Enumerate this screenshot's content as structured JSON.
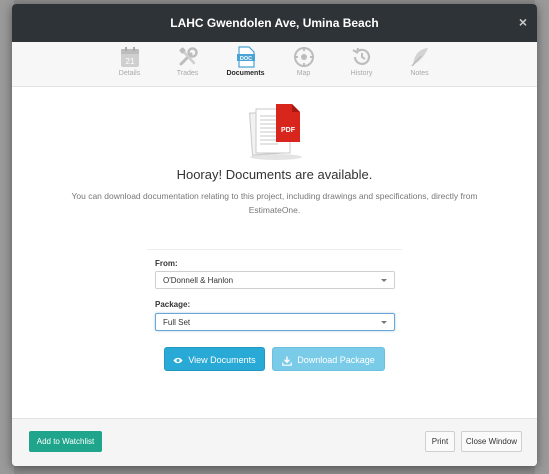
{
  "modal": {
    "title": "LAHC Gwendolen Ave, Umina Beach",
    "close_glyph": "×"
  },
  "tabs": [
    {
      "label": "Details",
      "icon": "calendar-icon",
      "calendar_day": "21"
    },
    {
      "label": "Trades",
      "icon": "tools-icon"
    },
    {
      "label": "Documents",
      "icon": "document-icon",
      "icon_text": "DOC",
      "active": true
    },
    {
      "label": "Map",
      "icon": "map-icon"
    },
    {
      "label": "History",
      "icon": "history-icon"
    },
    {
      "label": "Notes",
      "icon": "feather-icon"
    }
  ],
  "content": {
    "illustration_badge": "PDF",
    "headline": "Hooray! Documents are available.",
    "description": "You can download documentation relating to this project, including drawings and specifications, directly from EstimateOne.",
    "from": {
      "label": "From:",
      "value": "O'Donnell & Hanlon"
    },
    "package": {
      "label": "Package:",
      "value": "Full Set"
    },
    "view_button": "View Documents",
    "download_button": "Download Package"
  },
  "footer": {
    "watchlist_button": "Add to Watchlist",
    "print_button": "Print",
    "close_button": "Close Window"
  },
  "colors": {
    "header_bg": "#2e3338",
    "primary": "#29a9d6",
    "primary_light": "#79cbe8",
    "success": "#1fa58b",
    "pdf_red": "#d9261c"
  }
}
